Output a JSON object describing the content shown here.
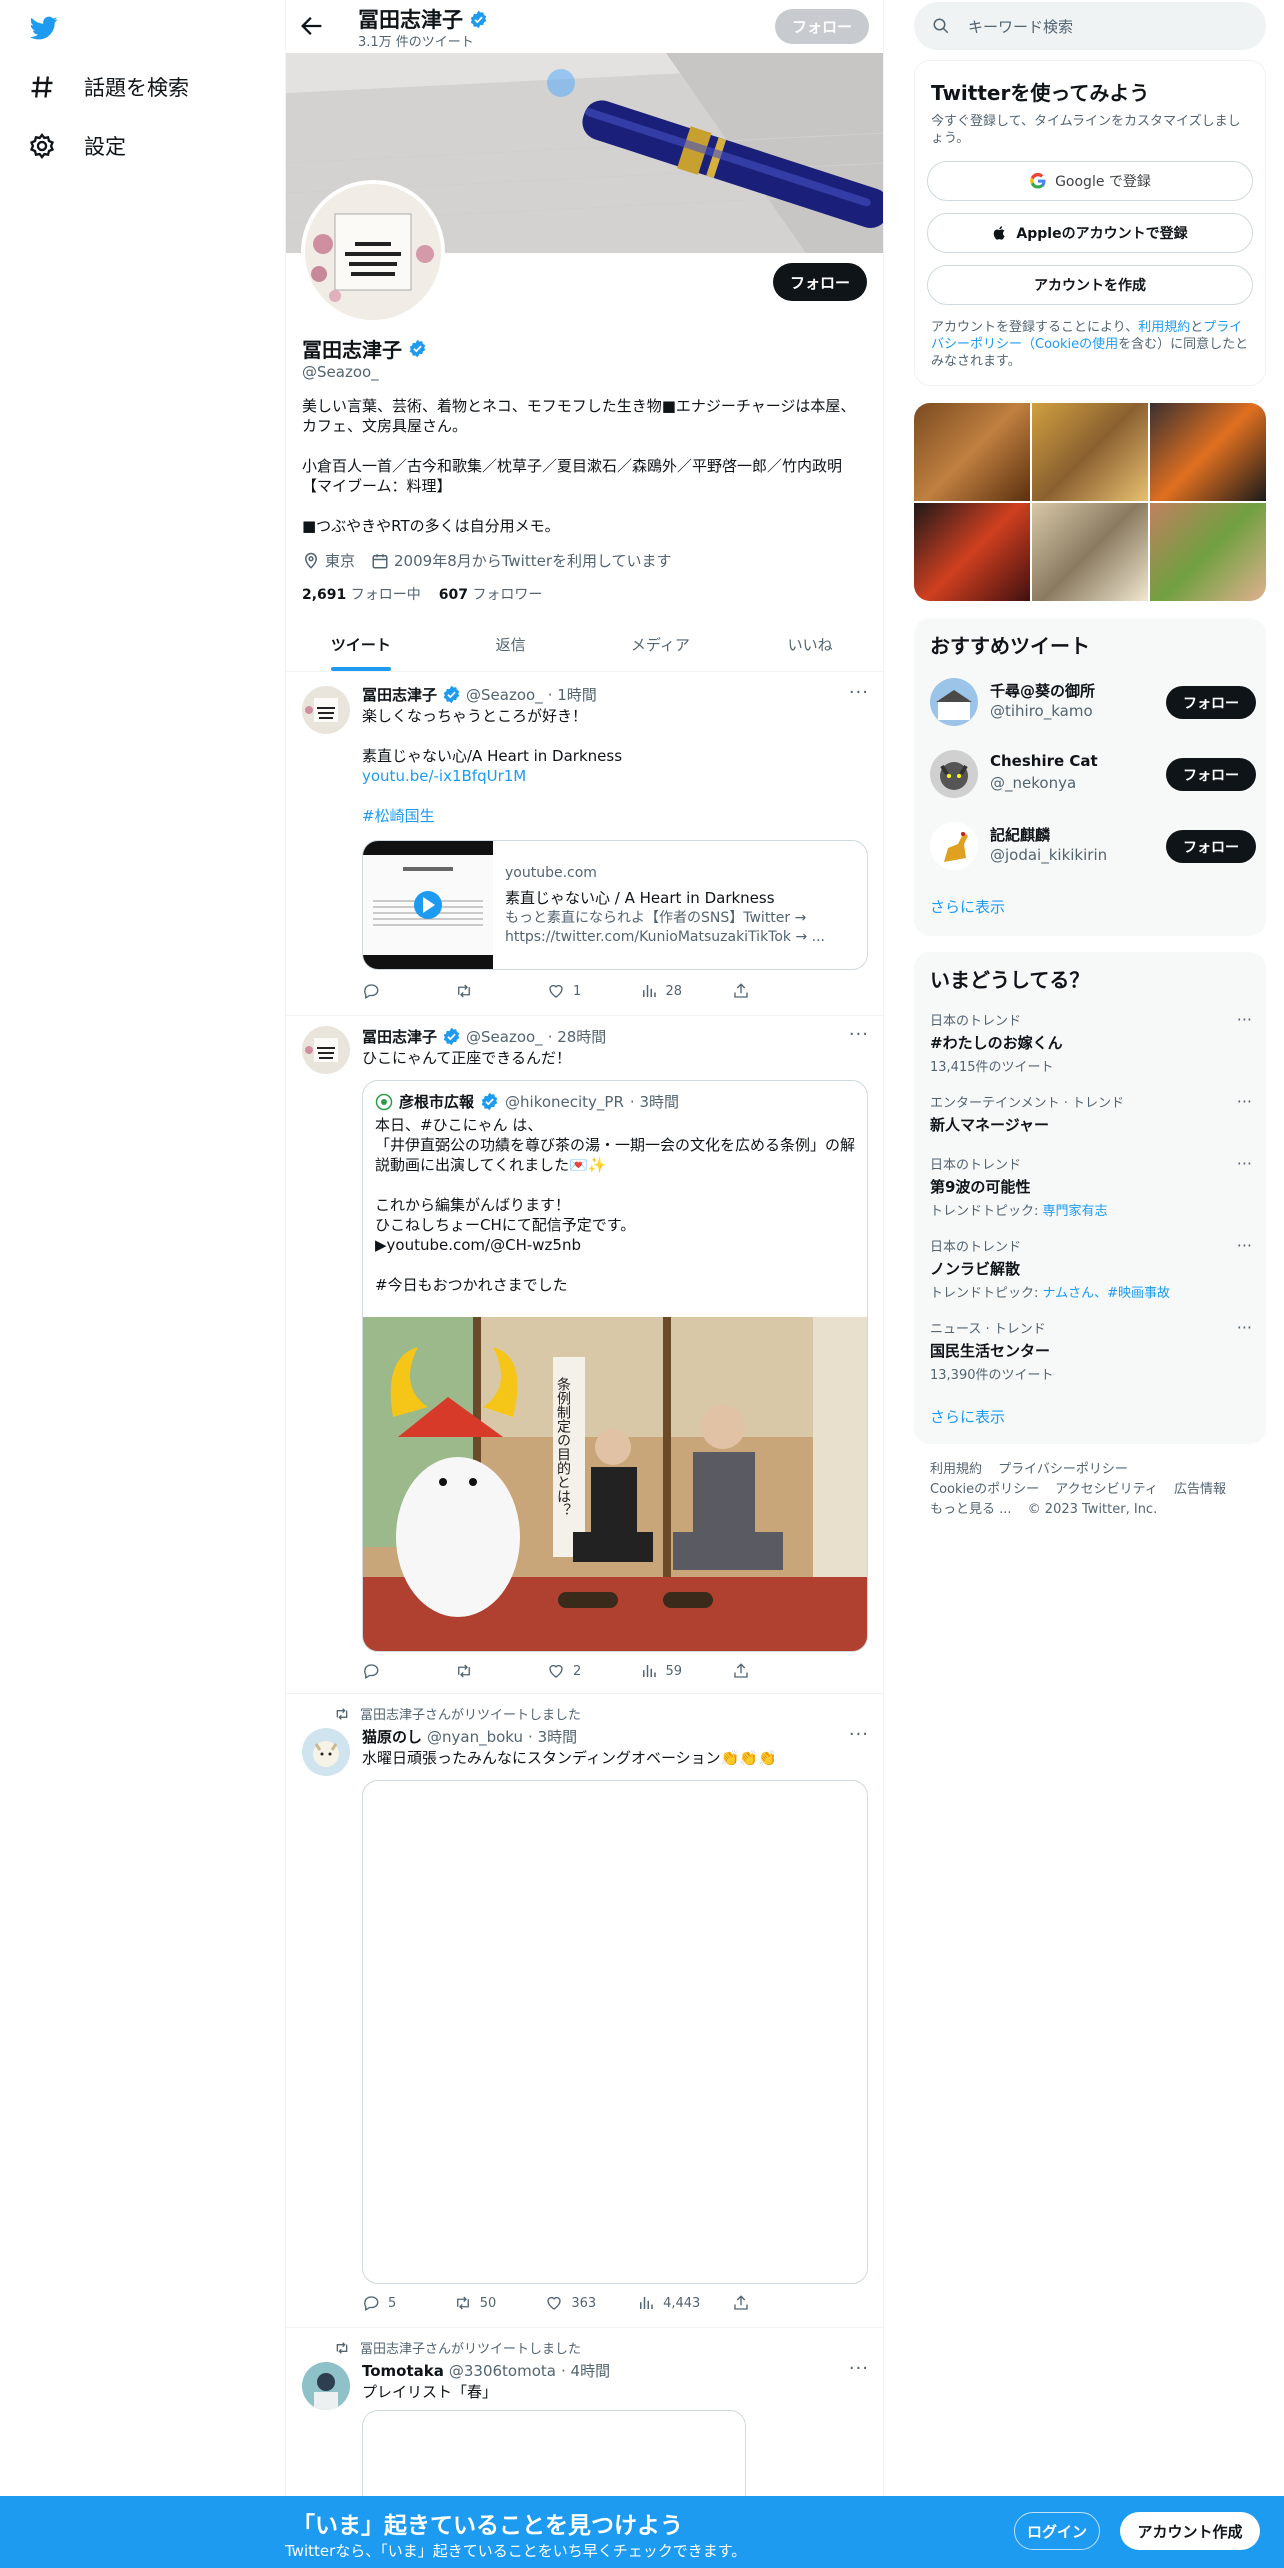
{
  "nav": {
    "items": [
      {
        "label": "話題を検索",
        "icon": "hashtag-icon"
      },
      {
        "label": "設定",
        "icon": "gear-icon"
      }
    ]
  },
  "header": {
    "name": "冨田志津子",
    "tweet_count": "3.1万 件のツイート",
    "follow_label": "フォロー"
  },
  "profile": {
    "name": "冨田志津子",
    "handle": "@Seazoo_",
    "follow_label": "フォロー",
    "bio": "美しい言葉、芸術、着物とネコ、モフモフした生き物■エナジーチャージは本屋、カフェ、文房具屋さん。\n\n小倉百人一首／古今和歌集／枕草子／夏目漱石／森鴎外／平野啓一郎／竹内政明【マイブーム：料理】\n\n■つぶやきやRTの多くは自分用メモ。",
    "location": "東京",
    "joined": "2009年8月からTwitterを利用しています",
    "following_count": "2,691",
    "following_label": "フォロー中",
    "followers_count": "607",
    "followers_label": "フォロワー"
  },
  "tabs": [
    "ツイート",
    "返信",
    "メディア",
    "いいね"
  ],
  "tweets": [
    {
      "name": "冨田志津子",
      "handle": "@Seazoo_",
      "time": "· 1時間",
      "text": "楽しくなっちゃうところが好き！\n\n素直じゃない心/A Heart in Darkness",
      "link": "youtu.be/-ix1BfqUr1M",
      "hashtag": "#松崎国生",
      "card": {
        "domain": "youtube.com",
        "title": "素直じゃない心 / A Heart in Darkness",
        "desc": "もっと素直になられよ【作者のSNS】Twitter → https://twitter.com/KunioMatsuzakiTikTok → ..."
      },
      "replies": "",
      "retweets": "",
      "likes": "1",
      "views": "28"
    },
    {
      "name": "冨田志津子",
      "handle": "@Seazoo_",
      "time": "· 28時間",
      "text": "ひこにゃんて正座できるんだ！",
      "quote": {
        "name": "彦根市広報",
        "handle": "@hikonecity_PR",
        "time": "· 3時間",
        "text": "本日、#ひこにゃん は、\n「井伊直弼公の功績を尊び茶の湯・一期一会の文化を広める条例」の解説動画に出演してくれました💌✨\n\nこれから編集がんばります！\nひこねしちょーCHにて配信予定です。\n▶youtube.com/@CH-wz5nb\n\n#今日もおつかれさまでした",
        "banner_text": "条例制定の目的とは？"
      },
      "replies": "",
      "retweets": "",
      "likes": "2",
      "views": "59"
    },
    {
      "retweeted_by": "冨田志津子さんがリツイートしました",
      "name": "猫原のし",
      "handle": "@nyan_boku",
      "time": "· 3時間",
      "text": "水曜日頑張ったみんなにスタンディングオベーション👏👏👏",
      "replies": "5",
      "retweets": "50",
      "likes": "363",
      "views": "4,443"
    },
    {
      "retweeted_by": "冨田志津子さんがリツイートしました",
      "name": "Tomotaka",
      "handle": "@3306tomota",
      "time": "· 4時間",
      "text": "プレイリスト「春」"
    }
  ],
  "search": {
    "placeholder": "キーワード検索"
  },
  "signup": {
    "title": "Twitterを使ってみよう",
    "sub": "今すぐ登録して、タイムラインをカスタマイズしましょう。",
    "google": "Google で登録",
    "apple": "Appleのアカウントで登録",
    "create": "アカウントを作成",
    "legal_pre": "アカウントを登録することにより、",
    "legal_terms": "利用規約",
    "legal_and": "と",
    "legal_privacy": "プライバシーポリシー（Cookieの使用",
    "legal_post": "を含む）に同意したとみなされます。"
  },
  "recommended": {
    "title": "おすすめツイート",
    "users": [
      {
        "name": "千尋@葵の御所",
        "handle": "@tihiro_kamo",
        "button": "フォロー"
      },
      {
        "name": "Cheshire Cat",
        "handle": "@_nekonya",
        "button": "フォロー"
      },
      {
        "name": "記紀麒麟",
        "handle": "@jodai_kikikirin",
        "button": "フォロー"
      }
    ],
    "more": "さらに表示"
  },
  "trends": {
    "title": "いまどうしてる？",
    "items": [
      {
        "context": "日本のトレンド",
        "topic": "#わたしのお嫁くん",
        "sub": "13,415件のツイート",
        "sub_links": ""
      },
      {
        "context": "エンターテインメント · トレンド",
        "topic": "新人マネージャー",
        "sub": "",
        "sub_links": ""
      },
      {
        "context": "日本のトレンド",
        "topic": "第9波の可能性",
        "sub": "トレンドトピック: ",
        "sub_links": "専門家有志"
      },
      {
        "context": "日本のトレンド",
        "topic": "ノンラビ解散",
        "sub": "トレンドトピック: ",
        "sub_links": "ナムさん、#映画事故"
      },
      {
        "context": "ニュース · トレンド",
        "topic": "国民生活センター",
        "sub": "13,390件のツイート",
        "sub_links": ""
      }
    ],
    "more": "さらに表示"
  },
  "footer": {
    "links": [
      "利用規約",
      "プライバシーポリシー",
      "Cookieのポリシー",
      "アクセシビリティ",
      "広告情報",
      "もっと見る ...",
      "© 2023 Twitter, Inc."
    ]
  },
  "bottom": {
    "title": "「いま」起きていることを見つけよう",
    "sub": "Twitterなら、「いま」起きていることをいち早くチェックできます。",
    "login": "ログイン",
    "create": "アカウント作成"
  },
  "colors": {
    "accent": "#1d9bf0",
    "text": "#0f1419",
    "muted": "#536471"
  }
}
